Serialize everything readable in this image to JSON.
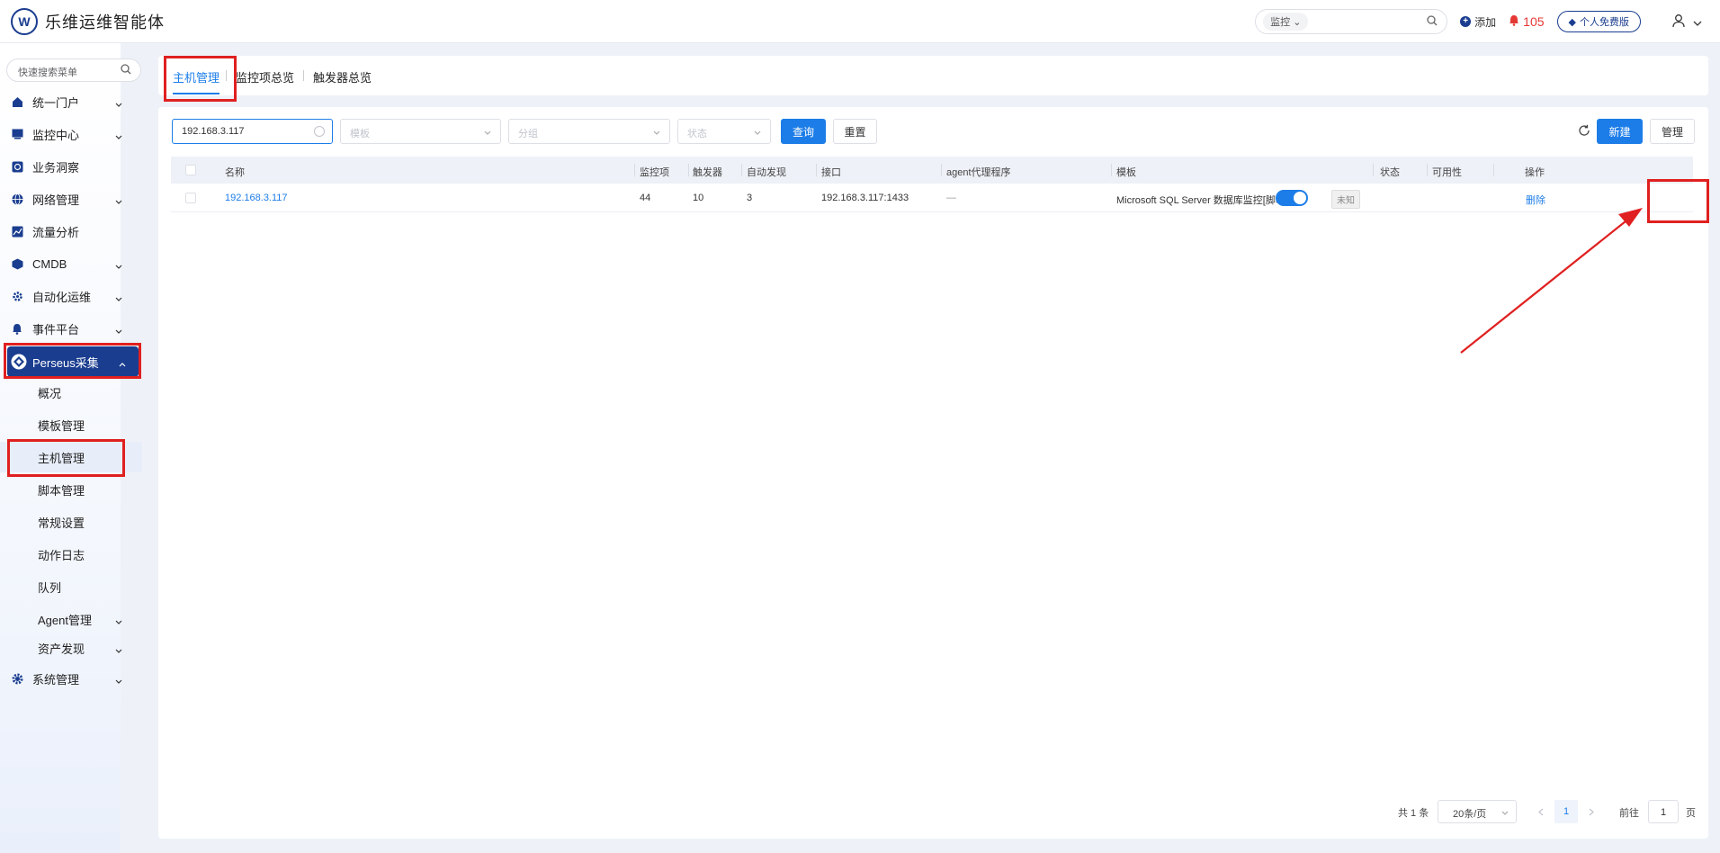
{
  "header": {
    "logo_mark": "W",
    "app_title": "乐维运维智能体",
    "search_category": "监控",
    "add_label": "添加",
    "alarm_count": "105",
    "edition_label": "个人免费版"
  },
  "sidebar": {
    "search_placeholder": "快速搜索菜单",
    "items": [
      {
        "label": "统一门户",
        "icon": "home-icon"
      },
      {
        "label": "监控中心",
        "icon": "monitor-icon"
      },
      {
        "label": "业务洞察",
        "icon": "insight-icon"
      },
      {
        "label": "网络管理",
        "icon": "globe-icon"
      },
      {
        "label": "流量分析",
        "icon": "chart-icon"
      },
      {
        "label": "CMDB",
        "icon": "cube-icon"
      },
      {
        "label": "自动化运维",
        "icon": "automation-icon"
      },
      {
        "label": "事件平台",
        "icon": "bell-icon"
      },
      {
        "label": "Perseus采集",
        "icon": "perseus-icon"
      },
      {
        "label": "系统管理",
        "icon": "gear-icon"
      }
    ],
    "sub_items": [
      "概况",
      "模板管理",
      "主机管理",
      "脚本管理",
      "常规设置",
      "动作日志",
      "队列",
      "Agent管理",
      "资产发现"
    ]
  },
  "tabs": [
    "主机管理",
    "监控项总览",
    "触发器总览"
  ],
  "filters": {
    "host_value": "192.168.3.117",
    "template_placeholder": "模板",
    "group_placeholder": "分组",
    "status_placeholder": "状态",
    "query_label": "查询",
    "reset_label": "重置",
    "new_label": "新建",
    "manage_label": "管理"
  },
  "table": {
    "columns": [
      "名称",
      "监控项",
      "触发器",
      "自动发现",
      "接口",
      "agent代理程序",
      "模板",
      "状态",
      "可用性",
      "操作"
    ],
    "rows": [
      {
        "name": "192.168.3.117",
        "items": "44",
        "triggers": "10",
        "discovery": "3",
        "interface": "192.168.3.117:1433",
        "agent": "—",
        "template": "Microsoft SQL Server 数据库监控[脚本]",
        "availability": "未知",
        "action": "删除"
      }
    ]
  },
  "pagination": {
    "total": "共 1 条",
    "page_size": "20条/页",
    "current_page": "1",
    "goto_label": "前往",
    "goto_value": "1",
    "page_suffix": "页"
  },
  "colors": {
    "accent": "#1d7de8",
    "brand": "#1a3d8f",
    "annotation": "#e02020"
  }
}
